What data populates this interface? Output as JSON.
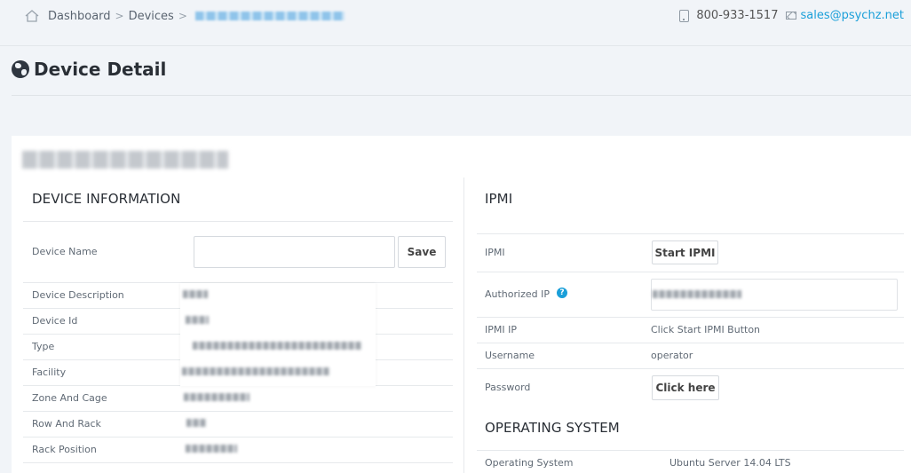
{
  "breadcrumb": {
    "home_icon": "home-icon",
    "dashboard": "Dashboard",
    "devices": "Devices",
    "separator": ">"
  },
  "contact": {
    "phone": "800-933-1517",
    "email": "sales@psychz.net",
    "phone_icon": "phone-icon",
    "mail_icon": "mail-icon"
  },
  "page": {
    "title": "Device Detail",
    "title_icon": "globe-icon"
  },
  "device_info": {
    "heading": "DEVICE INFORMATION",
    "name_label": "Device Name",
    "name_value": "",
    "save_label": "Save",
    "rows": [
      {
        "label": "Device Description"
      },
      {
        "label": "Device Id"
      },
      {
        "label": "Type"
      },
      {
        "label": "Facility"
      },
      {
        "label": "Zone And Cage"
      },
      {
        "label": "Row And Rack"
      },
      {
        "label": "Rack Position"
      }
    ]
  },
  "ipmi": {
    "heading": "IPMI",
    "ipmi_label": "IPMI",
    "start_label": "Start IPMI",
    "authorized_ip_label": "Authorized IP",
    "help_icon": "?",
    "ipmi_ip_label": "IPMI IP",
    "ipmi_ip_value": "Click Start IPMI Button",
    "username_label": "Username",
    "username_value": "operator",
    "password_label": "Password",
    "password_button": "Click here"
  },
  "os": {
    "heading": "OPERATING SYSTEM",
    "label": "Operating System",
    "value": "Ubuntu Server 14.04 LTS"
  },
  "colors": {
    "accent": "#1a9fd9",
    "background": "#f1f4f8",
    "card": "#ffffff"
  }
}
